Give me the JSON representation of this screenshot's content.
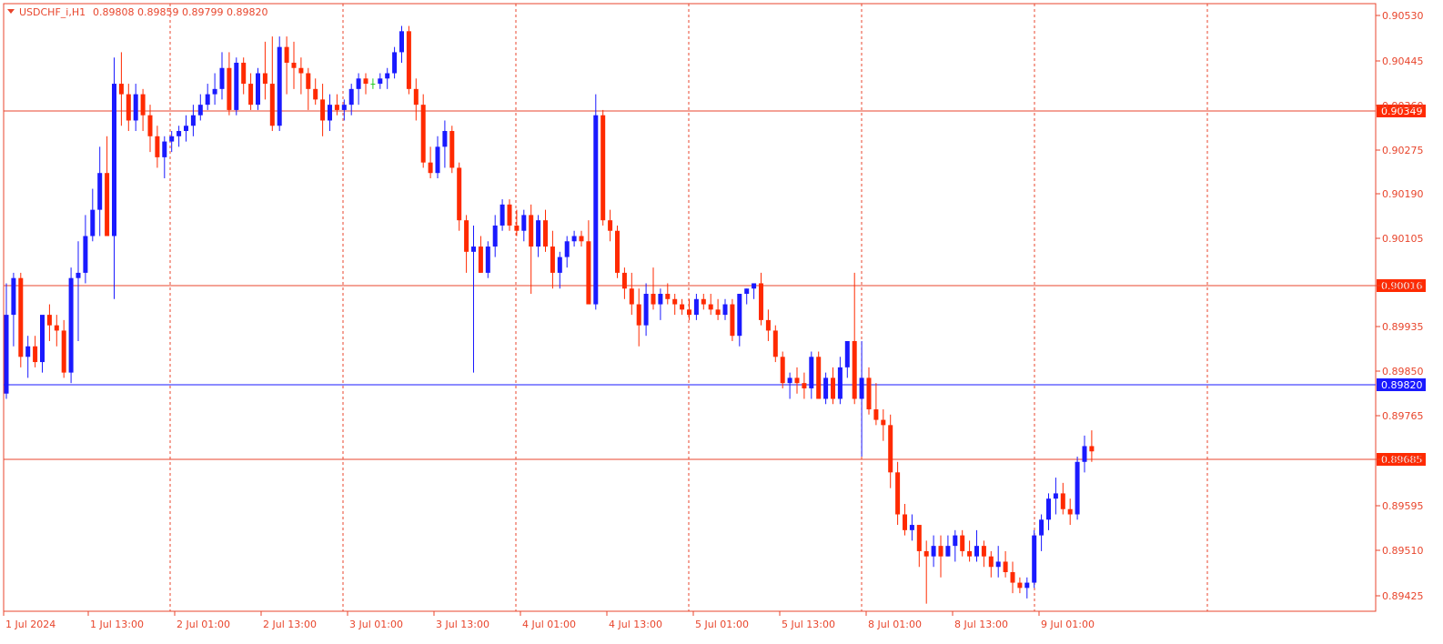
{
  "header": {
    "symbol": "USDCHF_i,H1",
    "ohlc": "0.89808 0.89859 0.89799 0.89820"
  },
  "colors": {
    "bull": "#1a1aff",
    "bear": "#ff2a00",
    "grid": "#e8452c",
    "hline": "#e8452c",
    "current_line": "#1a1aff",
    "text": "#e8452c",
    "tag_bg": "#ff2a00",
    "current_tag_bg": "#1a1aff",
    "doji": "#22cc22"
  },
  "chart_data": {
    "type": "candlestick",
    "timeframe": "H1",
    "ylim": [
      0.8939,
      0.9056
    ],
    "y_ticks": [
      "0.90530",
      "0.90445",
      "0.90360",
      "0.90275",
      "0.90190",
      "0.90105",
      "0.90016",
      "0.89935",
      "0.89850",
      "0.89765",
      "0.89685",
      "0.89595",
      "0.89510",
      "0.89425"
    ],
    "x_ticks": [
      "1 Jul 2024",
      "1 Jul 13:00",
      "2 Jul 01:00",
      "2 Jul 13:00",
      "3 Jul 01:00",
      "3 Jul 13:00",
      "4 Jul 01:00",
      "4 Jul 13:00",
      "5 Jul 01:00",
      "5 Jul 13:00",
      "8 Jul 01:00",
      "8 Jul 13:00",
      "9 Jul 01:00"
    ],
    "horizontal_levels": [
      {
        "price": 0.90349,
        "label": "0.90349"
      },
      {
        "price": 0.90016,
        "label": "0.90016"
      },
      {
        "price": 0.89685,
        "label": "0.89685"
      }
    ],
    "current_price": {
      "price": 0.8982,
      "label": "0.89820"
    },
    "grid": "vertical dashed at x ticks",
    "candles": [
      [
        0.8981,
        0.9002,
        0.898,
        0.8996
      ],
      [
        0.8996,
        0.9004,
        0.899,
        0.9003
      ],
      [
        0.9003,
        0.9004,
        0.8986,
        0.8988
      ],
      [
        0.8988,
        0.8992,
        0.8984,
        0.899
      ],
      [
        0.899,
        0.8992,
        0.8986,
        0.8987
      ],
      [
        0.8987,
        0.8995,
        0.8985,
        0.8996
      ],
      [
        0.8996,
        0.8998,
        0.8991,
        0.8994
      ],
      [
        0.8994,
        0.8996,
        0.899,
        0.8993
      ],
      [
        0.8993,
        0.8995,
        0.8984,
        0.8985
      ],
      [
        0.8985,
        0.9005,
        0.8983,
        0.9003
      ],
      [
        0.9003,
        0.901,
        0.8991,
        0.9004
      ],
      [
        0.9004,
        0.9015,
        0.9002,
        0.9011
      ],
      [
        0.9011,
        0.902,
        0.901,
        0.9016
      ],
      [
        0.9016,
        0.9028,
        0.9011,
        0.9023
      ],
      [
        0.9023,
        0.903,
        0.9012,
        0.9011
      ],
      [
        0.9011,
        0.9045,
        0.8999,
        0.904
      ],
      [
        0.904,
        0.9046,
        0.9032,
        0.9038
      ],
      [
        0.9038,
        0.904,
        0.9031,
        0.9033
      ],
      [
        0.9033,
        0.904,
        0.9031,
        0.9038
      ],
      [
        0.9038,
        0.9039,
        0.9031,
        0.9034
      ],
      [
        0.9034,
        0.9036,
        0.9027,
        0.903
      ],
      [
        0.903,
        0.9032,
        0.9024,
        0.9026
      ],
      [
        0.9026,
        0.903,
        0.9022,
        0.9029
      ],
      [
        0.9029,
        0.9031,
        0.9027,
        0.903
      ],
      [
        0.903,
        0.9032,
        0.9028,
        0.9031
      ],
      [
        0.9031,
        0.9034,
        0.9029,
        0.9032
      ],
      [
        0.9032,
        0.9036,
        0.903,
        0.9034
      ],
      [
        0.9034,
        0.9038,
        0.9033,
        0.9036
      ],
      [
        0.9036,
        0.904,
        0.9035,
        0.9038
      ],
      [
        0.9038,
        0.9042,
        0.9036,
        0.9039
      ],
      [
        0.9039,
        0.9046,
        0.9037,
        0.9043
      ],
      [
        0.9043,
        0.9046,
        0.9034,
        0.9035
      ],
      [
        0.9035,
        0.9045,
        0.9034,
        0.9044
      ],
      [
        0.9044,
        0.9045,
        0.9038,
        0.904
      ],
      [
        0.904,
        0.9042,
        0.9035,
        0.9036
      ],
      [
        0.9036,
        0.9043,
        0.9035,
        0.9042
      ],
      [
        0.9042,
        0.9048,
        0.9037,
        0.904
      ],
      [
        0.904,
        0.9049,
        0.9031,
        0.9032
      ],
      [
        0.9032,
        0.9049,
        0.9031,
        0.9047
      ],
      [
        0.9047,
        0.9049,
        0.9038,
        0.9044
      ],
      [
        0.9044,
        0.9048,
        0.9039,
        0.9043
      ],
      [
        0.9043,
        0.9045,
        0.9038,
        0.9042
      ],
      [
        0.9042,
        0.9043,
        0.9035,
        0.9039
      ],
      [
        0.9039,
        0.9041,
        0.9036,
        0.9037
      ],
      [
        0.9037,
        0.904,
        0.903,
        0.9033
      ],
      [
        0.9033,
        0.9038,
        0.9031,
        0.9036
      ],
      [
        0.9036,
        0.9038,
        0.9034,
        0.9035
      ],
      [
        0.9035,
        0.9037,
        0.9033,
        0.9036
      ],
      [
        0.9036,
        0.904,
        0.9034,
        0.9039
      ],
      [
        0.9039,
        0.9042,
        0.9036,
        0.9041
      ],
      [
        0.9041,
        0.9042,
        0.9038,
        0.904
      ],
      [
        0.904,
        0.9041,
        0.9039,
        0.904
      ],
      [
        0.904,
        0.9042,
        0.9039,
        0.9041
      ],
      [
        0.9041,
        0.9043,
        0.9039,
        0.9042
      ],
      [
        0.9042,
        0.9047,
        0.9041,
        0.9046
      ],
      [
        0.9046,
        0.9051,
        0.9044,
        0.905
      ],
      [
        0.905,
        0.9051,
        0.9038,
        0.9039
      ],
      [
        0.9039,
        0.9041,
        0.9033,
        0.9036
      ],
      [
        0.9036,
        0.9038,
        0.9024,
        0.9025
      ],
      [
        0.9025,
        0.9028,
        0.9022,
        0.9023
      ],
      [
        0.9023,
        0.903,
        0.9022,
        0.9028
      ],
      [
        0.9028,
        0.9033,
        0.9024,
        0.9031
      ],
      [
        0.9031,
        0.9032,
        0.9023,
        0.9024
      ],
      [
        0.9024,
        0.9025,
        0.9012,
        0.9014
      ],
      [
        0.9014,
        0.9015,
        0.9004,
        0.9008
      ],
      [
        0.9008,
        0.9013,
        0.8985,
        0.9009
      ],
      [
        0.9009,
        0.9011,
        0.9004,
        0.9004
      ],
      [
        0.9004,
        0.901,
        0.9003,
        0.9009
      ],
      [
        0.9009,
        0.9015,
        0.9007,
        0.9013
      ],
      [
        0.9013,
        0.9018,
        0.9012,
        0.9017
      ],
      [
        0.9017,
        0.9018,
        0.9012,
        0.9013
      ],
      [
        0.9013,
        0.9016,
        0.9011,
        0.9012
      ],
      [
        0.9012,
        0.9016,
        0.901,
        0.9015
      ],
      [
        0.9015,
        0.9017,
        0.9,
        0.9009
      ],
      [
        0.9009,
        0.9015,
        0.9007,
        0.9014
      ],
      [
        0.9014,
        0.9016,
        0.9008,
        0.9009
      ],
      [
        0.9009,
        0.9012,
        0.9001,
        0.9004
      ],
      [
        0.9004,
        0.9008,
        0.9001,
        0.9007
      ],
      [
        0.9007,
        0.9011,
        0.9005,
        0.901
      ],
      [
        0.901,
        0.9012,
        0.9009,
        0.9011
      ],
      [
        0.9011,
        0.9012,
        0.9009,
        0.901
      ],
      [
        0.901,
        0.9014,
        0.9007,
        0.8998
      ],
      [
        0.8998,
        0.9038,
        0.8997,
        0.9034
      ],
      [
        0.9034,
        0.9035,
        0.9013,
        0.9014
      ],
      [
        0.9014,
        0.9016,
        0.901,
        0.9012
      ],
      [
        0.9012,
        0.9013,
        0.9003,
        0.9004
      ],
      [
        0.9004,
        0.9005,
        0.8999,
        0.9001
      ],
      [
        0.9001,
        0.9004,
        0.8996,
        0.8998
      ],
      [
        0.8998,
        0.9001,
        0.899,
        0.8994
      ],
      [
        0.8994,
        0.9002,
        0.8992,
        0.9
      ],
      [
        0.9,
        0.9005,
        0.8997,
        0.8998
      ],
      [
        0.8998,
        0.9001,
        0.8995,
        0.9
      ],
      [
        0.9,
        0.9002,
        0.8998,
        0.8999
      ],
      [
        0.8999,
        0.9,
        0.8996,
        0.8998
      ],
      [
        0.8998,
        0.8999,
        0.8996,
        0.8997
      ],
      [
        0.8997,
        0.8999,
        0.8995,
        0.8996
      ],
      [
        0.8996,
        0.9,
        0.8995,
        0.8999
      ],
      [
        0.8999,
        0.9,
        0.8997,
        0.8998
      ],
      [
        0.8998,
        0.9,
        0.8996,
        0.8997
      ],
      [
        0.8997,
        0.8999,
        0.8995,
        0.8996
      ],
      [
        0.8996,
        0.8999,
        0.8995,
        0.8998
      ],
      [
        0.8998,
        0.8999,
        0.8991,
        0.8992
      ],
      [
        0.8992,
        0.9,
        0.899,
        0.9
      ],
      [
        0.9,
        0.9001,
        0.8998,
        0.9001
      ],
      [
        0.9001,
        0.9002,
        0.8999,
        0.9002
      ],
      [
        0.9002,
        0.9004,
        0.8994,
        0.8995
      ],
      [
        0.8995,
        0.8997,
        0.8991,
        0.8993
      ],
      [
        0.8993,
        0.8994,
        0.8987,
        0.8988
      ],
      [
        0.8988,
        0.8989,
        0.8982,
        0.8983
      ],
      [
        0.8983,
        0.8985,
        0.898,
        0.8984
      ],
      [
        0.8984,
        0.8986,
        0.8981,
        0.8983
      ],
      [
        0.8983,
        0.8985,
        0.898,
        0.8982
      ],
      [
        0.8982,
        0.8989,
        0.898,
        0.8988
      ],
      [
        0.8988,
        0.8989,
        0.898,
        0.898
      ],
      [
        0.898,
        0.8985,
        0.8979,
        0.8984
      ],
      [
        0.8984,
        0.8986,
        0.8979,
        0.898
      ],
      [
        0.898,
        0.8988,
        0.8979,
        0.8986
      ],
      [
        0.8986,
        0.8991,
        0.8984,
        0.8991
      ],
      [
        0.8991,
        0.9004,
        0.8979,
        0.898
      ],
      [
        0.898,
        0.8991,
        0.8969,
        0.8984
      ],
      [
        0.8984,
        0.8986,
        0.8977,
        0.8978
      ],
      [
        0.8978,
        0.8983,
        0.8975,
        0.8976
      ],
      [
        0.8976,
        0.8978,
        0.8972,
        0.8975
      ],
      [
        0.8975,
        0.8977,
        0.8963,
        0.8966
      ],
      [
        0.8966,
        0.8968,
        0.8956,
        0.8958
      ],
      [
        0.8958,
        0.896,
        0.8954,
        0.8955
      ],
      [
        0.8955,
        0.8958,
        0.8953,
        0.8956
      ],
      [
        0.8956,
        0.8956,
        0.8948,
        0.8951
      ],
      [
        0.8951,
        0.8953,
        0.8941,
        0.895
      ],
      [
        0.895,
        0.8954,
        0.8948,
        0.8952
      ],
      [
        0.8952,
        0.8954,
        0.8946,
        0.895
      ],
      [
        0.895,
        0.8954,
        0.895,
        0.8952
      ],
      [
        0.8952,
        0.8955,
        0.8949,
        0.8954
      ],
      [
        0.8954,
        0.8955,
        0.895,
        0.8951
      ],
      [
        0.8951,
        0.8953,
        0.8949,
        0.895
      ],
      [
        0.895,
        0.8955,
        0.8949,
        0.8952
      ],
      [
        0.8952,
        0.8953,
        0.8948,
        0.895
      ],
      [
        0.895,
        0.8951,
        0.8946,
        0.8948
      ],
      [
        0.8948,
        0.8952,
        0.8946,
        0.8949
      ],
      [
        0.8949,
        0.8951,
        0.8946,
        0.8947
      ],
      [
        0.8947,
        0.8949,
        0.8943,
        0.8945
      ],
      [
        0.8945,
        0.8946,
        0.8943,
        0.8944
      ],
      [
        0.8944,
        0.8946,
        0.8942,
        0.8945
      ],
      [
        0.8945,
        0.8955,
        0.8944,
        0.8954
      ],
      [
        0.8954,
        0.8958,
        0.8951,
        0.8957
      ],
      [
        0.8957,
        0.8962,
        0.8955,
        0.8961
      ],
      [
        0.8961,
        0.8965,
        0.8958,
        0.8962
      ],
      [
        0.8962,
        0.8964,
        0.8958,
        0.8959
      ],
      [
        0.8959,
        0.8961,
        0.8956,
        0.8958
      ],
      [
        0.8958,
        0.8969,
        0.8957,
        0.8968
      ],
      [
        0.8968,
        0.8973,
        0.8966,
        0.8971
      ],
      [
        0.8971,
        0.8974,
        0.8968,
        0.897
      ],
      [
        0.897,
        0.8973,
        0.8967,
        0.8971
      ],
      [
        0.8971,
        0.8972,
        0.8966,
        0.8969
      ],
      [
        0.8969,
        0.8971,
        0.8966,
        0.897
      ],
      [
        0.897,
        0.8972,
        0.8967,
        0.8968
      ],
      [
        0.8968,
        0.8972,
        0.8967,
        0.8971
      ],
      [
        0.8971,
        0.8975,
        0.8969,
        0.8974
      ],
      [
        0.8974,
        0.8977,
        0.897,
        0.8973
      ],
      [
        0.8973,
        0.8976,
        0.897,
        0.8975
      ],
      [
        0.8975,
        0.8979,
        0.8973,
        0.8977
      ],
      [
        0.8977,
        0.8983,
        0.8975,
        0.8982
      ],
      [
        0.8982,
        0.8986,
        0.898,
        0.8985
      ],
      [
        0.8985,
        0.8989,
        0.8982,
        0.8983
      ],
      [
        0.8983,
        0.8985,
        0.8979,
        0.8981
      ],
      [
        0.8981,
        0.8987,
        0.8979,
        0.8982
      ]
    ]
  }
}
